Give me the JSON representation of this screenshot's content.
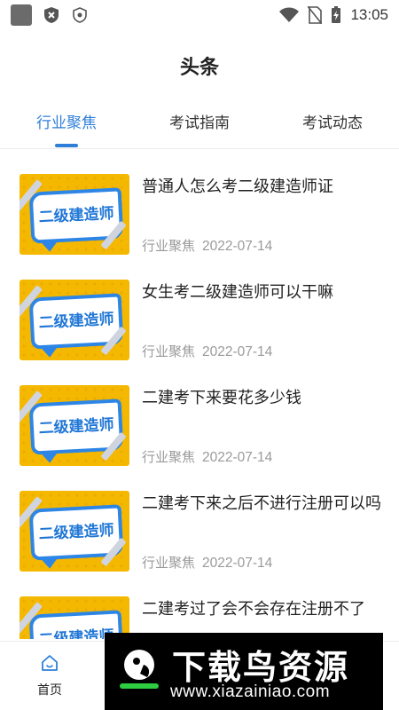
{
  "status_bar": {
    "time": "13:05",
    "icons": [
      "app-square-icon",
      "shield-x-icon",
      "shield-dot-icon",
      "wifi-icon",
      "no-sim-icon",
      "battery-charging-icon"
    ]
  },
  "header": {
    "title": "头条"
  },
  "tabs": [
    {
      "label": "行业聚焦",
      "active": true
    },
    {
      "label": "考试指南",
      "active": false
    },
    {
      "label": "考试动态",
      "active": false
    }
  ],
  "articles": [
    {
      "thumb_text": "二级建造师",
      "title": "普通人怎么考二级建造师证",
      "category": "行业聚焦",
      "date": "2022-07-14"
    },
    {
      "thumb_text": "二级建造师",
      "title": "女生考二级建造师可以干嘛",
      "category": "行业聚焦",
      "date": "2022-07-14"
    },
    {
      "thumb_text": "二级建造师",
      "title": "二建考下来要花多少钱",
      "category": "行业聚焦",
      "date": "2022-07-14"
    },
    {
      "thumb_text": "二级建造师",
      "title": "二建考下来之后不进行注册可以吗",
      "category": "行业聚焦",
      "date": "2022-07-14"
    },
    {
      "thumb_text": "二级建造师",
      "title": "二建考过了会不会存在注册不了",
      "category": "",
      "date": ""
    }
  ],
  "bottom_nav": {
    "home_label": "首页"
  },
  "watermark": {
    "text": "下载鸟资源",
    "url": "www.xiazainiao.com"
  },
  "colors": {
    "accent": "#2f7fd8",
    "thumb_bg": "#f5b800",
    "thumb_text": "#1f76d6"
  }
}
